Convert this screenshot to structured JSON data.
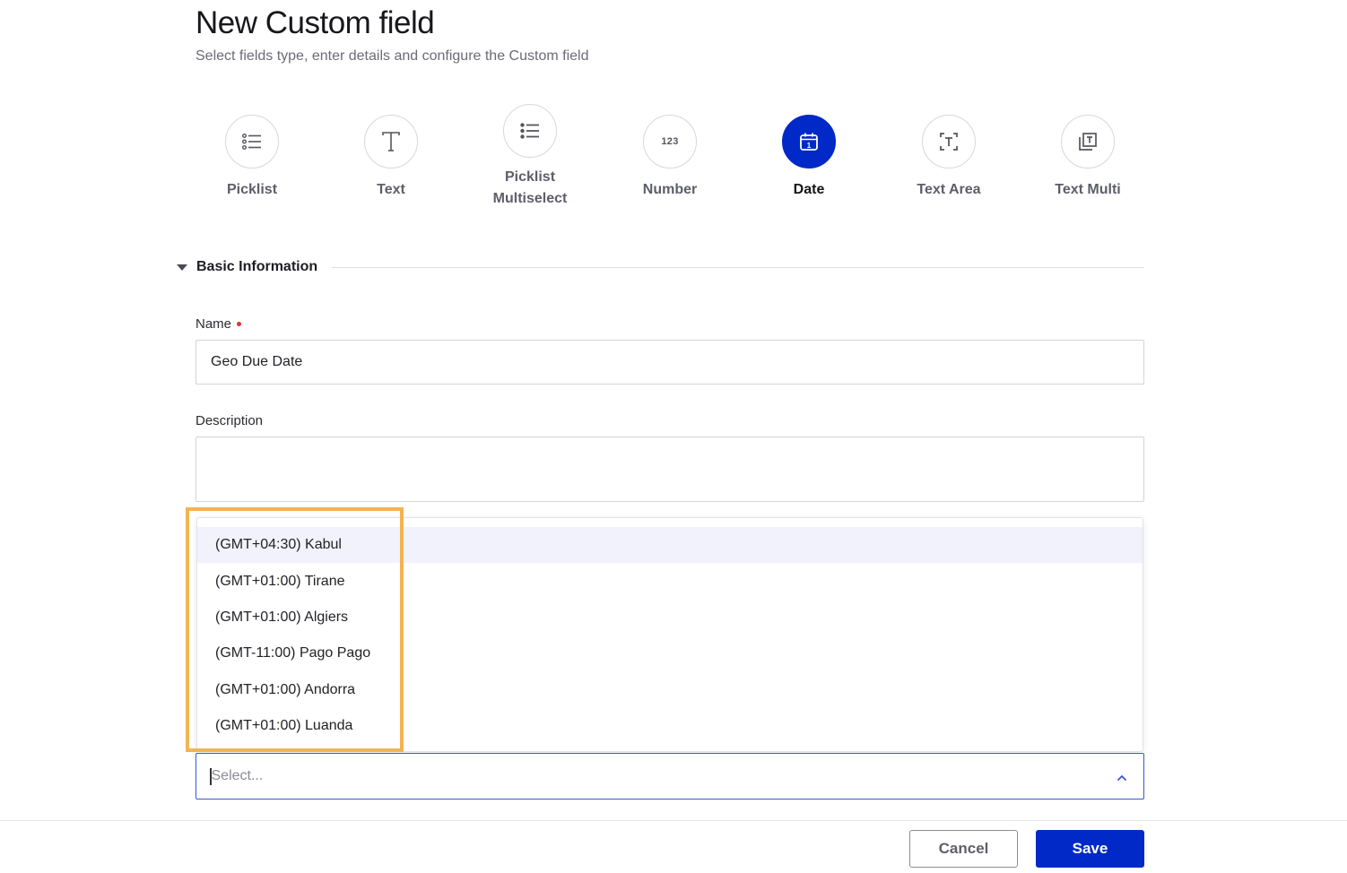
{
  "header": {
    "title": "New Custom field",
    "subtitle": "Select fields type, enter details and configure the Custom field"
  },
  "field_types": [
    {
      "label": "Picklist",
      "icon": "list-icon",
      "active": false
    },
    {
      "label": "Text",
      "icon": "text-t-icon",
      "active": false
    },
    {
      "label": "Picklist Multiselect",
      "icon": "list-bold-icon",
      "active": false
    },
    {
      "label": "Number",
      "icon": "number-123-icon",
      "glyph": "123",
      "active": false
    },
    {
      "label": "Date",
      "icon": "calendar-icon",
      "active": true
    },
    {
      "label": "Text Area",
      "icon": "text-area-icon",
      "active": false
    },
    {
      "label": "Text Multi",
      "icon": "text-multi-icon",
      "active": false
    }
  ],
  "section": {
    "title": "Basic Information",
    "expanded": true
  },
  "form": {
    "name_label": "Name",
    "name_required": true,
    "name_value": "Geo Due Date",
    "description_label": "Description",
    "description_value": ""
  },
  "timezone_dropdown": {
    "open": true,
    "placeholder": "Select...",
    "value": "",
    "options": [
      {
        "label": "(GMT+04:30) Kabul",
        "hovered": true
      },
      {
        "label": "(GMT+01:00) Tirane",
        "hovered": false
      },
      {
        "label": "(GMT+01:00) Algiers",
        "hovered": false
      },
      {
        "label": "(GMT-11:00) Pago Pago",
        "hovered": false
      },
      {
        "label": "(GMT+01:00) Andorra",
        "hovered": false
      },
      {
        "label": "(GMT+01:00) Luanda",
        "hovered": false
      }
    ]
  },
  "footer": {
    "cancel_label": "Cancel",
    "save_label": "Save"
  },
  "colors": {
    "primary": "#0029c7",
    "focus_border": "#3b57d6",
    "highlight": "#f2b451",
    "required": "#e0303a",
    "hover_row": "#f1f2fb"
  }
}
